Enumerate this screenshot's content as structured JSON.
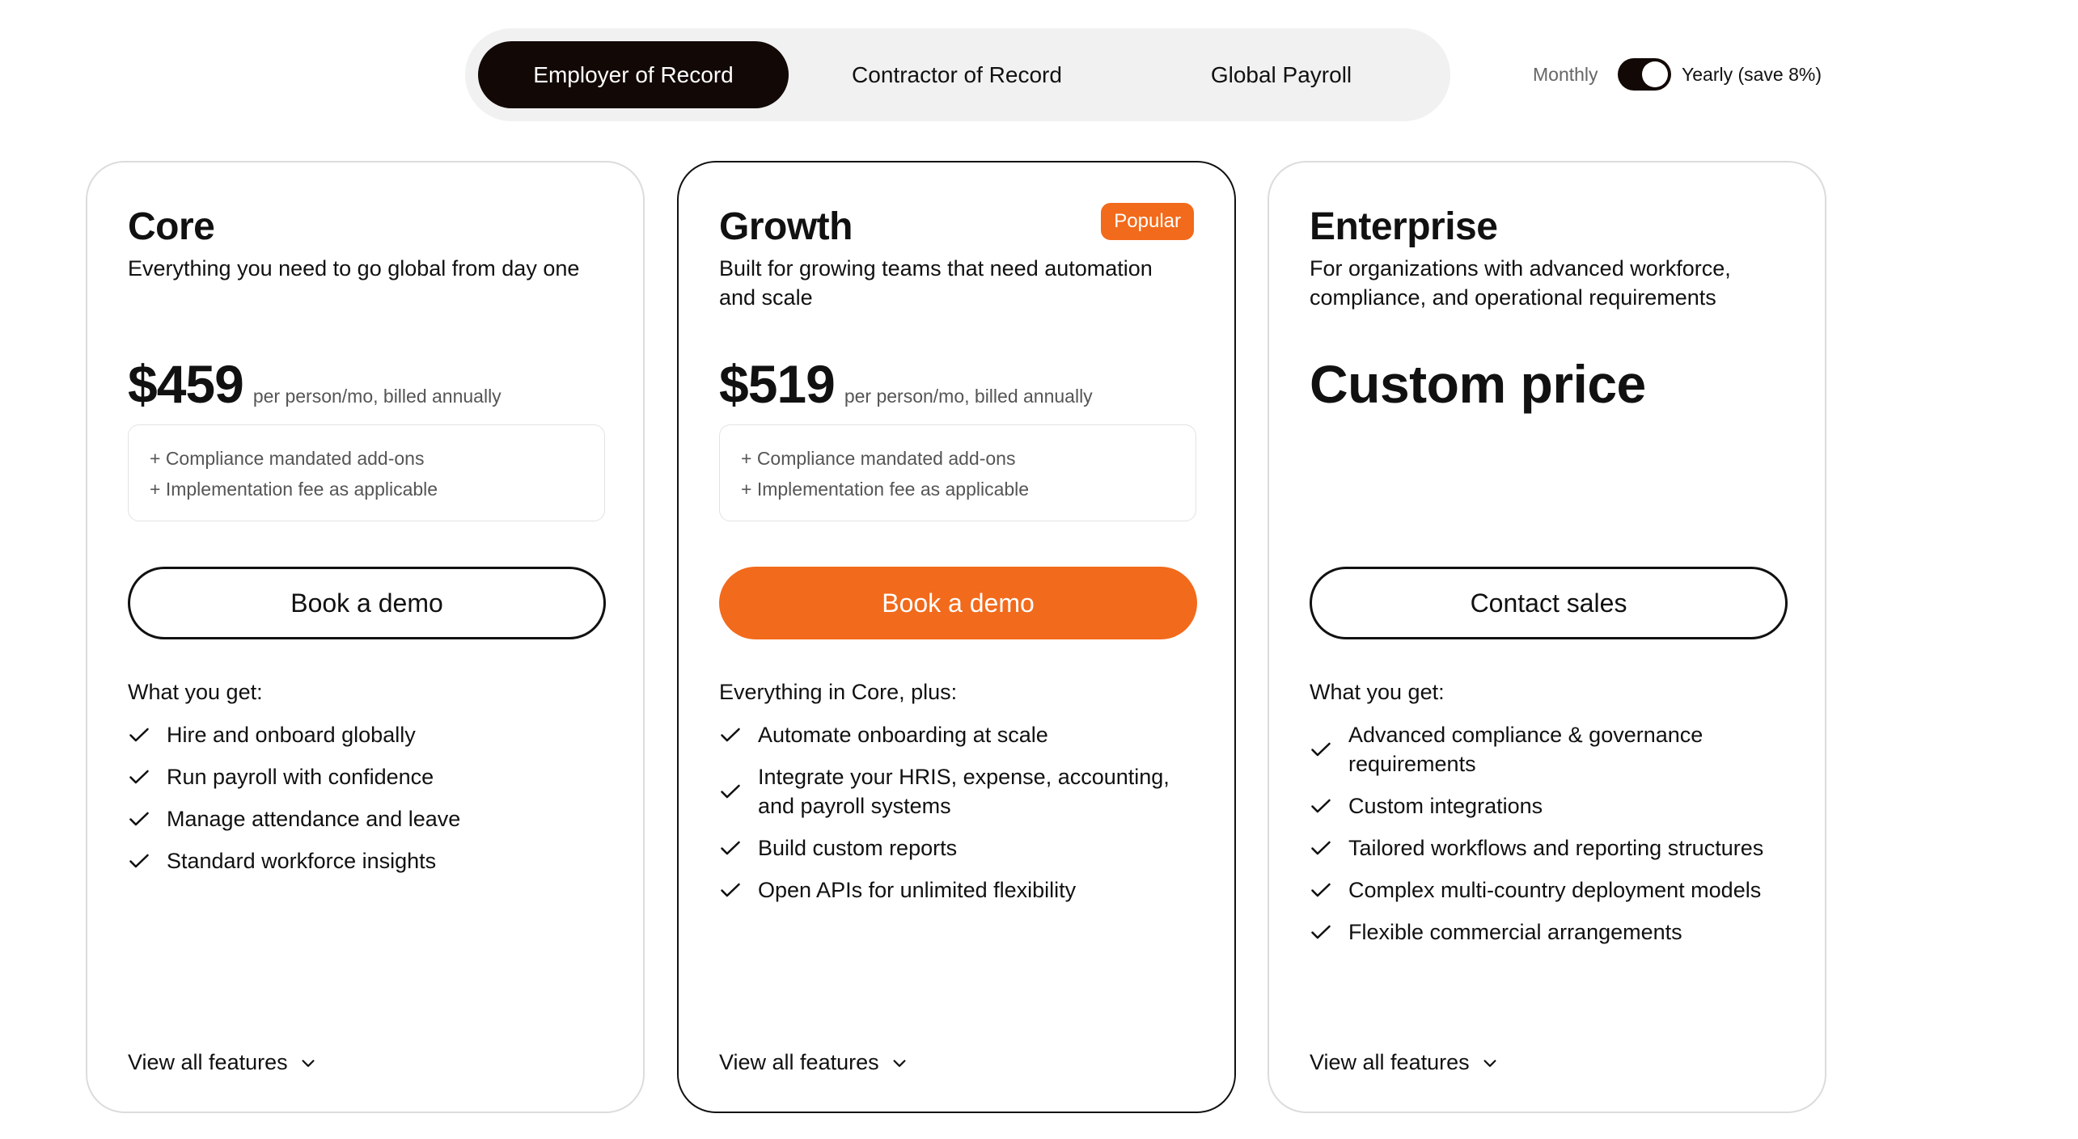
{
  "tabs": [
    {
      "label": "Employer of Record",
      "active": true
    },
    {
      "label": "Contractor of Record",
      "active": false
    },
    {
      "label": "Global Payroll",
      "active": false
    }
  ],
  "billing": {
    "monthly_label": "Monthly",
    "yearly_label": "Yearly (save 8%)",
    "selected": "yearly"
  },
  "colors": {
    "accent": "#f26a1b",
    "dark": "#120805",
    "card_border": "#dcdcdc"
  },
  "plans": [
    {
      "name": "Core",
      "description": "Everything you need to go global from day one",
      "price": "$459",
      "price_note": "per person/mo, billed annually",
      "addons": [
        "+ Compliance mandated add-ons",
        "+ Implementation fee as applicable"
      ],
      "cta": "Book a demo",
      "features_heading": "What you get:",
      "features": [
        "Hire and onboard globally",
        "Run payroll with confidence",
        "Manage attendance and leave",
        "Standard workforce insights"
      ],
      "view_all": "View all features"
    },
    {
      "name": "Growth",
      "badge": "Popular",
      "description": "Built for growing teams that need automation and scale",
      "price": "$519",
      "price_note": "per person/mo, billed annually",
      "addons": [
        "+ Compliance mandated add-ons",
        "+ Implementation fee as applicable"
      ],
      "cta": "Book a demo",
      "features_heading": "Everything in Core, plus:",
      "features": [
        "Automate onboarding at scale",
        "Integrate your HRIS, expense, accounting, and payroll systems",
        "Build custom reports",
        "Open APIs for unlimited flexibility"
      ],
      "view_all": "View all features"
    },
    {
      "name": "Enterprise",
      "description": "For organizations with advanced workforce, compliance, and operational requirements",
      "price": "Custom price",
      "cta": "Contact sales",
      "features_heading": "What you get:",
      "features": [
        "Advanced compliance & governance requirements",
        "Custom integrations",
        "Tailored workflows and reporting structures",
        "Complex multi-country deployment models",
        "Flexible commercial arrangements"
      ],
      "view_all": "View all features"
    }
  ]
}
